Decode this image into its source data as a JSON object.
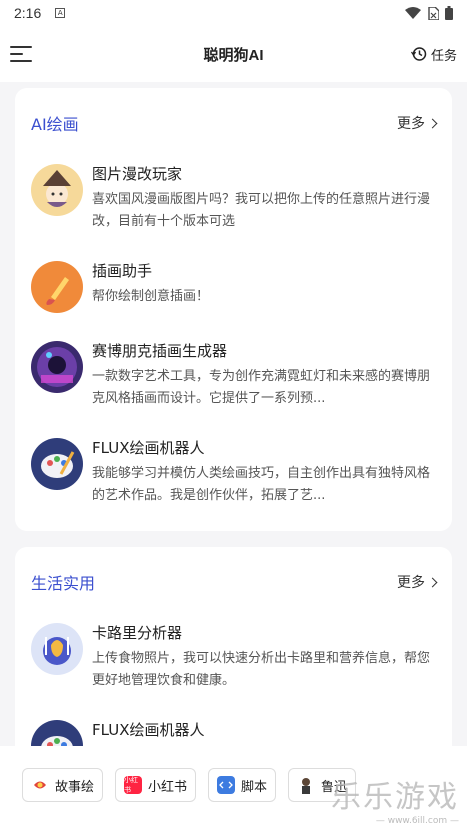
{
  "status_bar": {
    "time": "2:16",
    "notification_icon": "A"
  },
  "header": {
    "title": "聪明狗AI",
    "task_label": "任务"
  },
  "sections": [
    {
      "title": "AI绘画",
      "more_label": "更多",
      "items": [
        {
          "name": "图片漫改玩家",
          "desc": "喜欢国风漫画版图片吗？我可以把你上传的任意照片进行漫改，目前有十个版本可选"
        },
        {
          "name": "插画助手",
          "desc": "帮你绘制创意插画！"
        },
        {
          "name": "赛博朋克插画生成器",
          "desc": "一款数字艺术工具，专为创作充满霓虹灯和未来感的赛博朋克风格插画而设计。它提供了一系列预..."
        },
        {
          "name": "FLUX绘画机器人",
          "desc": "我能够学习并模仿人类绘画技巧，自主创作出具有独特风格的艺术作品。我是创作伙伴，拓展了艺..."
        }
      ]
    },
    {
      "title": "生活实用",
      "more_label": "更多",
      "items": [
        {
          "name": "卡路里分析器",
          "desc": "上传食物照片，我可以快速分析出卡路里和营养信息，帮您更好地管理饮食和健康。"
        },
        {
          "name": "FLUX绘画机器人",
          "desc": ""
        }
      ]
    }
  ],
  "bottom_chips": [
    {
      "label": "故事绘",
      "icon": "story-icon"
    },
    {
      "label": "小红书",
      "icon": "xiaohongshu-icon",
      "icon_text": "小红书"
    },
    {
      "label": "脚本",
      "icon": "script-icon"
    },
    {
      "label": "鲁迅",
      "icon": "luxun-icon"
    }
  ],
  "watermark": {
    "big": "乐乐游戏",
    "small": "— www.6ill.com —"
  },
  "colors": {
    "accent": "#3b4fcf",
    "background": "#f5f5f7"
  }
}
